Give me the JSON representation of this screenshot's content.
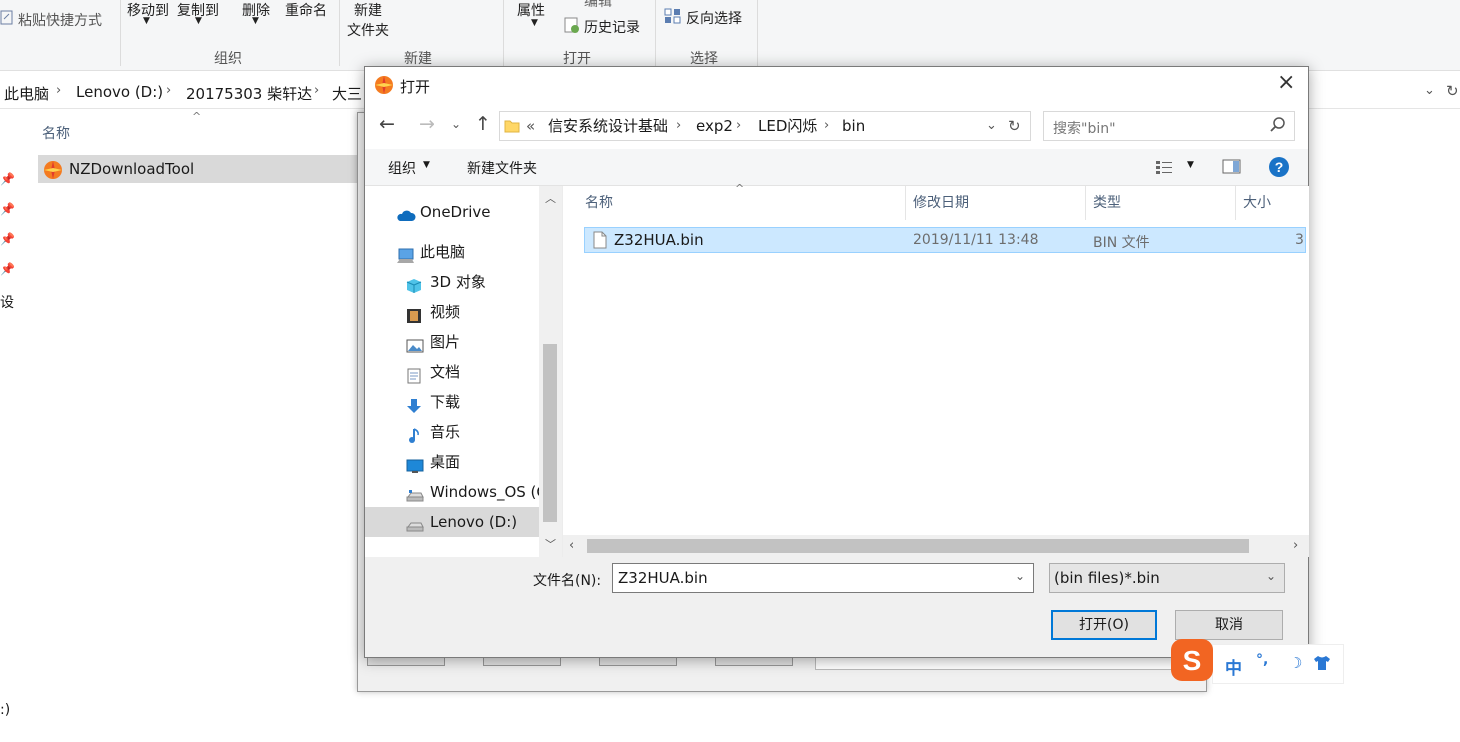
{
  "explorer": {
    "ribbon": {
      "paste_shortcut": "粘贴快捷方式",
      "move_to": "移动到",
      "copy_to": "复制到",
      "delete": "删除",
      "rename": "重命名",
      "new_line1": "新建",
      "new_line2": "文件夹",
      "properties": "属性",
      "edit": "编辑",
      "history": "历史记录",
      "invert_select": "反向选择",
      "group_organize": "组织",
      "group_new": "新建",
      "group_open": "打开",
      "group_select": "选择"
    },
    "breadcrumbs": [
      "此电脑",
      "Lenovo (D:)",
      "20175303 柴轩达",
      "大三"
    ],
    "column_name": "名称",
    "items": [
      {
        "name": "NZDownloadTool"
      }
    ],
    "left_partial": "设",
    "bottom_partial": ":)"
  },
  "dialog": {
    "title": "打开",
    "path": [
      "«",
      "信安系统设计基础",
      "exp2",
      "LED闪烁",
      "bin"
    ],
    "search_placeholder": "搜索\"bin\"",
    "organize": "组织",
    "new_folder": "新建文件夹",
    "nav_items": [
      {
        "label": "OneDrive",
        "icon": "cloud-icon"
      },
      {
        "label": "此电脑",
        "icon": "computer-icon"
      },
      {
        "label": "3D 对象",
        "icon": "cube-icon"
      },
      {
        "label": "视频",
        "icon": "video-icon"
      },
      {
        "label": "图片",
        "icon": "picture-icon"
      },
      {
        "label": "文档",
        "icon": "document-icon"
      },
      {
        "label": "下载",
        "icon": "download-icon"
      },
      {
        "label": "音乐",
        "icon": "music-icon"
      },
      {
        "label": "桌面",
        "icon": "desktop-icon"
      },
      {
        "label": "Windows_OS (C",
        "icon": "drive-icon"
      },
      {
        "label": "Lenovo (D:)",
        "icon": "drive-icon"
      }
    ],
    "columns": {
      "name": "名称",
      "modified": "修改日期",
      "type": "类型",
      "size": "大小"
    },
    "files": [
      {
        "name": "Z32HUA.bin",
        "modified": "2019/11/11 13:48",
        "type": "BIN 文件",
        "size": "3"
      }
    ],
    "filename_label": "文件名(N):",
    "filename_value": "Z32HUA.bin",
    "filter_value": "(bin files)*.bin",
    "open_button": "打开(O)",
    "cancel_button": "取消"
  },
  "ime": {
    "mode": "中",
    "punct": "°,"
  },
  "colors": {
    "selection": "#cce8ff",
    "selection_border": "#99d1ff",
    "accent": "#0078d7",
    "ime_orange": "#f26522"
  }
}
